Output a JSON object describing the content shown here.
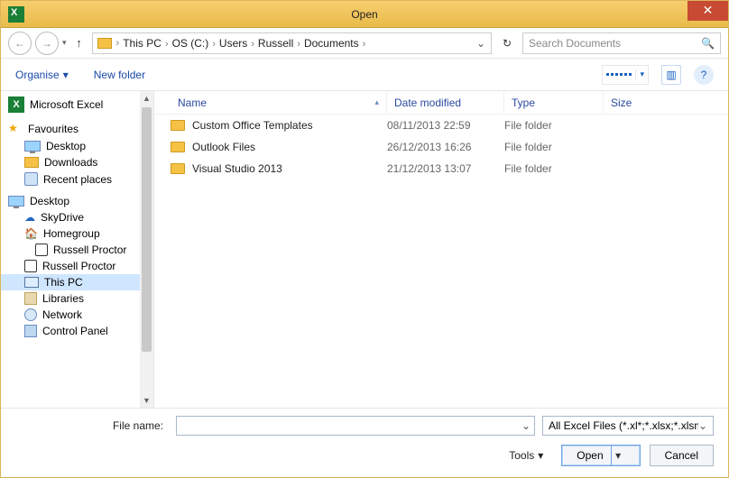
{
  "window": {
    "title": "Open",
    "close_glyph": "✕"
  },
  "nav": {
    "back_glyph": "←",
    "fwd_glyph": "→",
    "up_glyph": "↑",
    "crumbs": [
      "This PC",
      "OS (C:)",
      "Users",
      "Russell",
      "Documents"
    ],
    "sep": "›",
    "dd_glyph": "⌄",
    "refresh_glyph": "↻",
    "search_placeholder": "Search Documents",
    "search_icon": "🔍"
  },
  "toolbar": {
    "organise_label": "Organise",
    "organise_dd": "▾",
    "newfolder_label": "New folder",
    "help_glyph": "?"
  },
  "sidebar": {
    "excel_label": "Microsoft Excel",
    "fav_label": "Favourites",
    "fav_items": [
      "Desktop",
      "Downloads",
      "Recent places"
    ],
    "desk_label": "Desktop",
    "desk_items": [
      {
        "label": "SkyDrive",
        "cls": "ic-sky",
        "glyph": "☁"
      },
      {
        "label": "Homegroup",
        "cls": "ic-home",
        "glyph": "🏠"
      },
      {
        "label": "Russell Proctor",
        "cls": "ic-user",
        "glyph": "",
        "sub": true
      },
      {
        "label": "Russell Proctor",
        "cls": "ic-user",
        "glyph": ""
      },
      {
        "label": "This PC",
        "cls": "ic-pc",
        "glyph": "",
        "selected": true
      },
      {
        "label": "Libraries",
        "cls": "ic-lib",
        "glyph": ""
      },
      {
        "label": "Network",
        "cls": "ic-net",
        "glyph": ""
      },
      {
        "label": "Control Panel",
        "cls": "ic-cp",
        "glyph": ""
      }
    ]
  },
  "columns": {
    "name": "Name",
    "date": "Date modified",
    "type": "Type",
    "size": "Size",
    "sort_glyph": "▴"
  },
  "files": [
    {
      "name": "Custom Office Templates",
      "date": "08/11/2013 22:59",
      "type": "File folder"
    },
    {
      "name": "Outlook Files",
      "date": "26/12/2013 16:26",
      "type": "File folder"
    },
    {
      "name": "Visual Studio 2013",
      "date": "21/12/2013 13:07",
      "type": "File folder"
    }
  ],
  "footer": {
    "filename_label": "File name:",
    "filename_value": "",
    "filter_label": "All Excel Files (*.xl*;*.xlsx;*.xlsm;",
    "tools_label": "Tools",
    "tools_dd": "▾",
    "open_label": "Open",
    "open_dd": "▾",
    "cancel_label": "Cancel",
    "dd_glyph": "⌄"
  }
}
